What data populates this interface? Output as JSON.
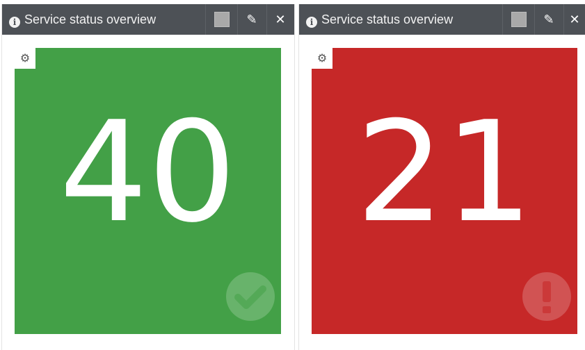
{
  "widgets": [
    {
      "title": "Service status overview",
      "value": "40",
      "status": "ok",
      "color": "#43a047",
      "status_icon": "check-icon"
    },
    {
      "title": "Service status overview",
      "value": "21",
      "status": "critical",
      "color": "#c62828",
      "status_icon": "exclamation-icon"
    }
  ],
  "icons": {
    "info": "i",
    "gear": "⚙",
    "pencil": "✎",
    "close": "✕"
  }
}
